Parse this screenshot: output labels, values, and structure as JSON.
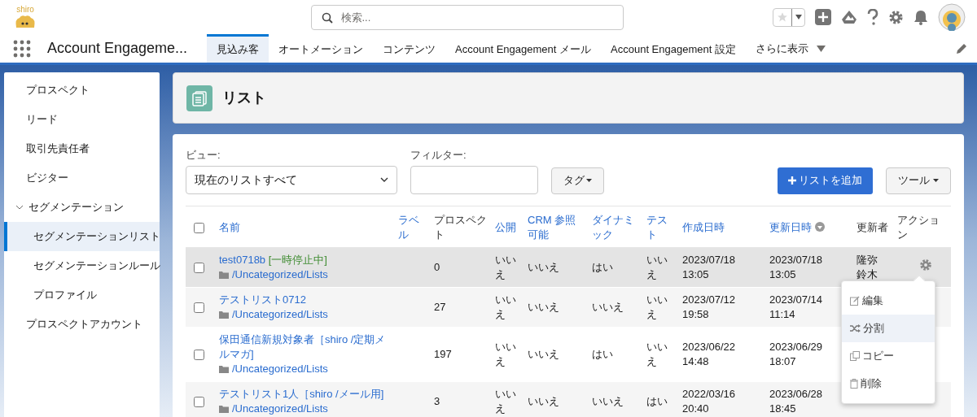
{
  "header": {
    "logo_text": "shiro",
    "search": {
      "placeholder": "検索..."
    }
  },
  "nav": {
    "app_name": "Account Engageme...",
    "tabs": [
      {
        "label": "見込み客",
        "selected": true
      },
      {
        "label": "オートメーション",
        "selected": false
      },
      {
        "label": "コンテンツ",
        "selected": false
      },
      {
        "label": "Account Engagement メール",
        "selected": false
      },
      {
        "label": "Account Engagement 設定",
        "selected": false
      }
    ],
    "more": "さらに表示"
  },
  "sidebar": {
    "items": [
      {
        "label": "プロスペクト",
        "selected": false
      },
      {
        "label": "リード",
        "selected": false
      },
      {
        "label": "取引先責任者",
        "selected": false
      },
      {
        "label": "ビジター",
        "selected": false
      },
      {
        "label": "セグメンテーション",
        "selected": false,
        "expanded": true,
        "children": [
          {
            "label": "セグメンテーションリスト",
            "selected": true
          },
          {
            "label": "セグメンテーションルール",
            "selected": false
          },
          {
            "label": "プロファイル",
            "selected": false
          }
        ]
      },
      {
        "label": "プロスペクトアカウント",
        "selected": false
      }
    ]
  },
  "page_header": {
    "title": "リスト"
  },
  "filters": {
    "view_label": "ビュー:",
    "view_value": "現在のリストすべて",
    "filter_label": "フィルター:",
    "tag_button": "タグ",
    "add_button": "リストを追加",
    "tools_button": "ツール"
  },
  "table": {
    "all_checked": false,
    "columns": [
      {
        "label": "名前",
        "sortable": true,
        "sorted": false
      },
      {
        "label": "ラベル",
        "sortable": true,
        "sorted": false
      },
      {
        "label": "プロスペクト",
        "sortable": false,
        "sorted": false
      },
      {
        "label": "公開",
        "sortable": true,
        "sorted": false
      },
      {
        "label": "CRM 参照可能",
        "sortable": true,
        "sorted": false
      },
      {
        "label": "ダイナミック",
        "sortable": true,
        "sorted": false
      },
      {
        "label": "テスト",
        "sortable": true,
        "sorted": false
      },
      {
        "label": "作成日時",
        "sortable": true,
        "sorted": false
      },
      {
        "label": "更新日時",
        "sortable": true,
        "sorted": true
      },
      {
        "label": "更新者",
        "sortable": false,
        "sorted": false
      },
      {
        "label": "アクション",
        "sortable": false,
        "sorted": false
      }
    ],
    "rows": [
      {
        "name": "test0718b",
        "status": "[一時停止中]",
        "folder": "/Uncategorized/Lists",
        "prospects": "0",
        "public": "いいえ",
        "crm": "いいえ",
        "dynamic": "はい",
        "test": "いいえ",
        "created": "2023/07/18 13:05",
        "updated": "2023/07/18 13:05",
        "updater": "隆弥鈴木",
        "checked": false,
        "active": true
      },
      {
        "name": "テストリスト0712",
        "folder": "/Uncategorized/Lists",
        "prospects": "27",
        "public": "いいえ",
        "crm": "いいえ",
        "dynamic": "いいえ",
        "test": "いいえ",
        "created": "2023/07/12 19:58",
        "updated": "2023/07/14 11:14",
        "checked": false,
        "active": false
      },
      {
        "name": "保田通信新規対象者［shiro /定期メルマガ]",
        "folder": "/Uncategorized/Lists",
        "prospects": "197",
        "public": "いいえ",
        "crm": "いいえ",
        "dynamic": "はい",
        "test": "いいえ",
        "created": "2023/06/22 14:48",
        "updated": "2023/06/29 18:07",
        "checked": false,
        "active": false
      },
      {
        "name": "テストリスト1人［shiro /メール用]",
        "folder": "/Uncategorized/Lists",
        "prospects": "3",
        "public": "いいえ",
        "crm": "いいえ",
        "dynamic": "いいえ",
        "test": "はい",
        "created": "2022/03/16 20:40",
        "updated": "2023/06/28 18:45",
        "checked": false,
        "active": false
      }
    ]
  },
  "action_menu": {
    "items": [
      {
        "label": "編集",
        "kind": "edit",
        "selected": false
      },
      {
        "label": "分割",
        "kind": "split",
        "selected": true
      },
      {
        "label": "コピー",
        "kind": "copy",
        "selected": false
      },
      {
        "label": "削除",
        "kind": "delete",
        "selected": false
      }
    ]
  }
}
